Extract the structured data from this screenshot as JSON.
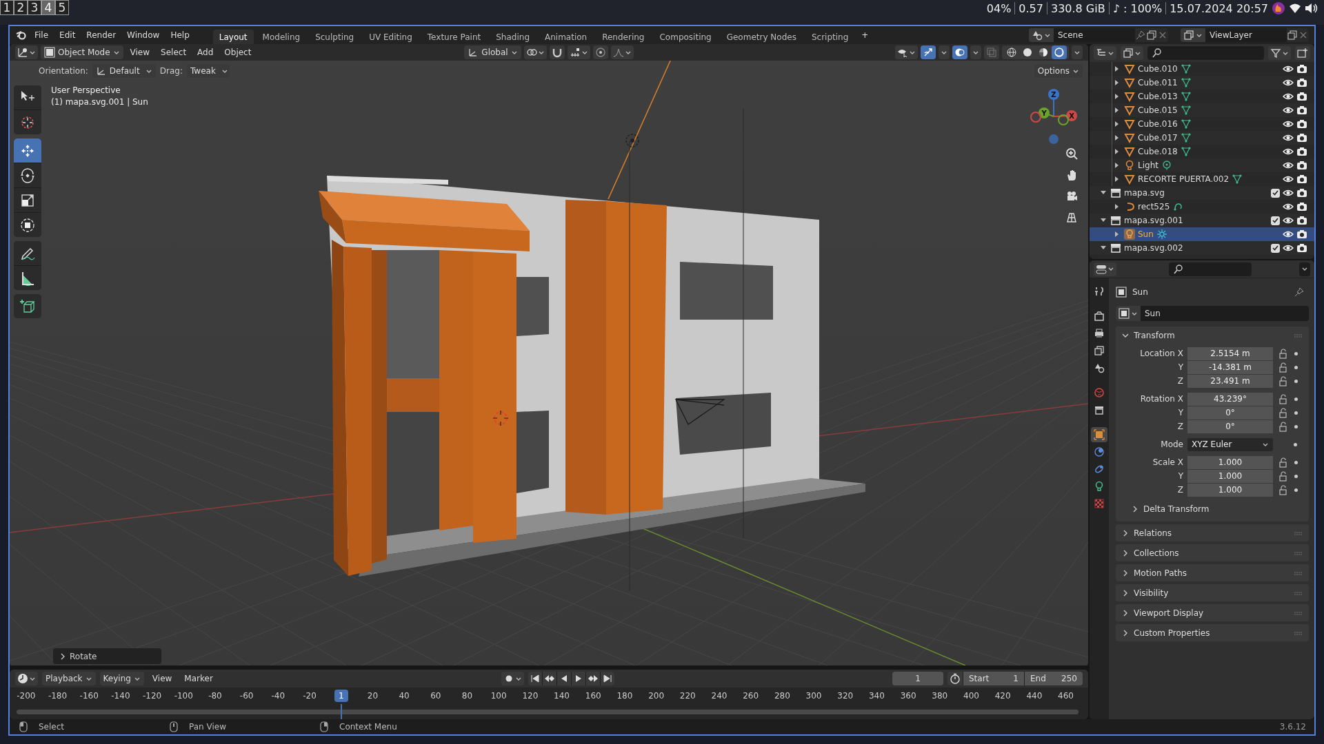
{
  "system_bar": {
    "workspaces": [
      {
        "label": "1",
        "selected": false
      },
      {
        "label": "2",
        "selected": false
      },
      {
        "label": "3",
        "selected": false
      },
      {
        "label": "4",
        "selected": true
      },
      {
        "label": "5",
        "selected": false
      }
    ],
    "status": [
      "04%",
      "0.57",
      "330.8 GiB",
      "♪ : 100%",
      "15.07.2024 20:57"
    ]
  },
  "top_bar": {
    "menus": [
      "File",
      "Edit",
      "Render",
      "Window",
      "Help"
    ],
    "workspaces": [
      {
        "label": "Layout",
        "selected": true
      },
      {
        "label": "Modeling",
        "selected": false
      },
      {
        "label": "Sculpting",
        "selected": false
      },
      {
        "label": "UV Editing",
        "selected": false
      },
      {
        "label": "Texture Paint",
        "selected": false
      },
      {
        "label": "Shading",
        "selected": false
      },
      {
        "label": "Animation",
        "selected": false
      },
      {
        "label": "Rendering",
        "selected": false
      },
      {
        "label": "Compositing",
        "selected": false
      },
      {
        "label": "Geometry Nodes",
        "selected": false
      },
      {
        "label": "Scripting",
        "selected": false
      }
    ],
    "add_workspace": "+",
    "scene": "Scene",
    "view_layer": "ViewLayer"
  },
  "viewport": {
    "mode": "Object Mode",
    "menus": [
      "View",
      "Select",
      "Add",
      "Object"
    ],
    "transform_orientation": "Global",
    "orientation_label": "Orientation:",
    "orientation": "Default",
    "drag_label": "Drag:",
    "drag": "Tweak",
    "options": "Options",
    "view_name": "User Perspective",
    "active_object": "(1) mapa.svg.001 | Sun",
    "tools": [
      {
        "kind": "select",
        "selected": false
      },
      {
        "kind": "cursor",
        "selected": false
      },
      {
        "kind": "move",
        "selected": true
      },
      {
        "kind": "rotate",
        "selected": false
      },
      {
        "kind": "scale",
        "selected": false
      },
      {
        "kind": "transform",
        "selected": false
      },
      {
        "kind": "annotate",
        "selected": false
      },
      {
        "kind": "measure",
        "selected": false
      },
      {
        "kind": "add-cube",
        "selected": false
      }
    ],
    "shading": [
      {
        "kind": "wireframe",
        "selected": false
      },
      {
        "kind": "solid",
        "selected": false
      },
      {
        "kind": "material",
        "selected": false
      },
      {
        "kind": "rendered",
        "selected": true
      }
    ],
    "gizmo": [
      "Z",
      "Y",
      "X"
    ],
    "last_operator": "Rotate"
  },
  "outliner": {
    "rows": [
      {
        "name": "Cube.010",
        "kind": "mesh",
        "expanded": false,
        "selected": false
      },
      {
        "name": "Cube.011",
        "kind": "mesh",
        "expanded": false,
        "selected": false
      },
      {
        "name": "Cube.013",
        "kind": "mesh",
        "expanded": false,
        "selected": false
      },
      {
        "name": "Cube.015",
        "kind": "mesh",
        "expanded": false,
        "selected": false
      },
      {
        "name": "Cube.016",
        "kind": "mesh",
        "expanded": false,
        "selected": false
      },
      {
        "name": "Cube.017",
        "kind": "mesh",
        "expanded": false,
        "selected": false
      },
      {
        "name": "Cube.018",
        "kind": "mesh",
        "expanded": false,
        "selected": false
      },
      {
        "name": "Light",
        "kind": "light",
        "expanded": false,
        "selected": false
      },
      {
        "name": "RECORTE PUERTA.002",
        "kind": "mesh",
        "expanded": false,
        "selected": false
      }
    ],
    "collections": [
      {
        "name": "mapa.svg",
        "expanded": true,
        "checked": true,
        "selected": false,
        "children": [
          {
            "name": "rect525",
            "kind": "curve",
            "expanded": false,
            "selected": false
          }
        ]
      },
      {
        "name": "mapa.svg.001",
        "expanded": true,
        "checked": true,
        "selected": false,
        "children": [
          {
            "name": "Sun",
            "kind": "sun",
            "expanded": false,
            "selected": true
          }
        ]
      },
      {
        "name": "mapa.svg.002",
        "expanded": true,
        "checked": true,
        "selected": false
      }
    ]
  },
  "properties": {
    "tabs": [
      {
        "kind": "tool",
        "selected": false
      },
      {
        "kind": "render",
        "selected": false
      },
      {
        "kind": "output",
        "selected": false
      },
      {
        "kind": "view-layer",
        "selected": false
      },
      {
        "kind": "scene",
        "selected": false
      },
      {
        "kind": "world",
        "selected": false
      },
      {
        "kind": "collection",
        "selected": false
      },
      {
        "kind": "object",
        "selected": true
      },
      {
        "kind": "physics",
        "selected": false
      },
      {
        "kind": "constraints",
        "selected": false
      },
      {
        "kind": "data",
        "selected": false
      },
      {
        "kind": "texture",
        "selected": false
      }
    ],
    "context": "Sun",
    "object_name": "Sun",
    "transform": {
      "title": "Transform",
      "expanded": true,
      "groups": [
        [
          {
            "label": "Location X",
            "value": "2.5154 m",
            "kind": "number"
          },
          {
            "label": "Y",
            "value": "-14.381 m",
            "kind": "number"
          },
          {
            "label": "Z",
            "value": "23.491 m",
            "kind": "number"
          }
        ],
        [
          {
            "label": "Rotation X",
            "value": "43.239°",
            "kind": "number"
          },
          {
            "label": "Y",
            "value": "0°",
            "kind": "number"
          },
          {
            "label": "Z",
            "value": "0°",
            "kind": "number"
          }
        ],
        [
          {
            "label": "Mode",
            "value": "XYZ Euler",
            "kind": "dropdown"
          }
        ],
        [
          {
            "label": "Scale X",
            "value": "1.000",
            "kind": "number"
          },
          {
            "label": "Y",
            "value": "1.000",
            "kind": "number"
          },
          {
            "label": "Z",
            "value": "1.000",
            "kind": "number"
          }
        ]
      ],
      "subpanels": [
        {
          "title": "Delta Transform",
          "expanded": false
        }
      ]
    },
    "panels": [
      {
        "title": "Relations",
        "expanded": false
      },
      {
        "title": "Collections",
        "expanded": false
      },
      {
        "title": "Motion Paths",
        "expanded": false
      },
      {
        "title": "Visibility",
        "expanded": false
      },
      {
        "title": "Viewport Display",
        "expanded": false
      },
      {
        "title": "Custom Properties",
        "expanded": false
      }
    ]
  },
  "timeline": {
    "menus": [
      "Playback",
      "Keying",
      "View",
      "Marker"
    ],
    "current_frame": "1",
    "start_label": "Start",
    "start": "1",
    "end_label": "End",
    "end": "250",
    "ticks": [
      {
        "label": "-200",
        "current": false
      },
      {
        "label": "-180",
        "current": false
      },
      {
        "label": "-160",
        "current": false
      },
      {
        "label": "-140",
        "current": false
      },
      {
        "label": "-120",
        "current": false
      },
      {
        "label": "-100",
        "current": false
      },
      {
        "label": "-80",
        "current": false
      },
      {
        "label": "-60",
        "current": false
      },
      {
        "label": "-40",
        "current": false
      },
      {
        "label": "-20",
        "current": false
      },
      {
        "label": "1",
        "current": true
      },
      {
        "label": "20",
        "current": false
      },
      {
        "label": "40",
        "current": false
      },
      {
        "label": "60",
        "current": false
      },
      {
        "label": "80",
        "current": false
      },
      {
        "label": "100",
        "current": false
      },
      {
        "label": "120",
        "current": false
      },
      {
        "label": "140",
        "current": false
      },
      {
        "label": "160",
        "current": false
      },
      {
        "label": "180",
        "current": false
      },
      {
        "label": "200",
        "current": false
      },
      {
        "label": "220",
        "current": false
      },
      {
        "label": "240",
        "current": false
      },
      {
        "label": "260",
        "current": false
      },
      {
        "label": "280",
        "current": false
      },
      {
        "label": "300",
        "current": false
      },
      {
        "label": "320",
        "current": false
      },
      {
        "label": "340",
        "current": false
      },
      {
        "label": "360",
        "current": false
      },
      {
        "label": "380",
        "current": false
      },
      {
        "label": "400",
        "current": false
      },
      {
        "label": "420",
        "current": false
      },
      {
        "label": "440",
        "current": false
      },
      {
        "label": "460",
        "current": false
      }
    ]
  },
  "status_bar": {
    "hints": [
      {
        "kind": "left",
        "label": "Select"
      },
      {
        "kind": "middle",
        "label": "Pan View"
      },
      {
        "kind": "right",
        "label": "Context Menu"
      }
    ],
    "version": "3.6.12"
  }
}
